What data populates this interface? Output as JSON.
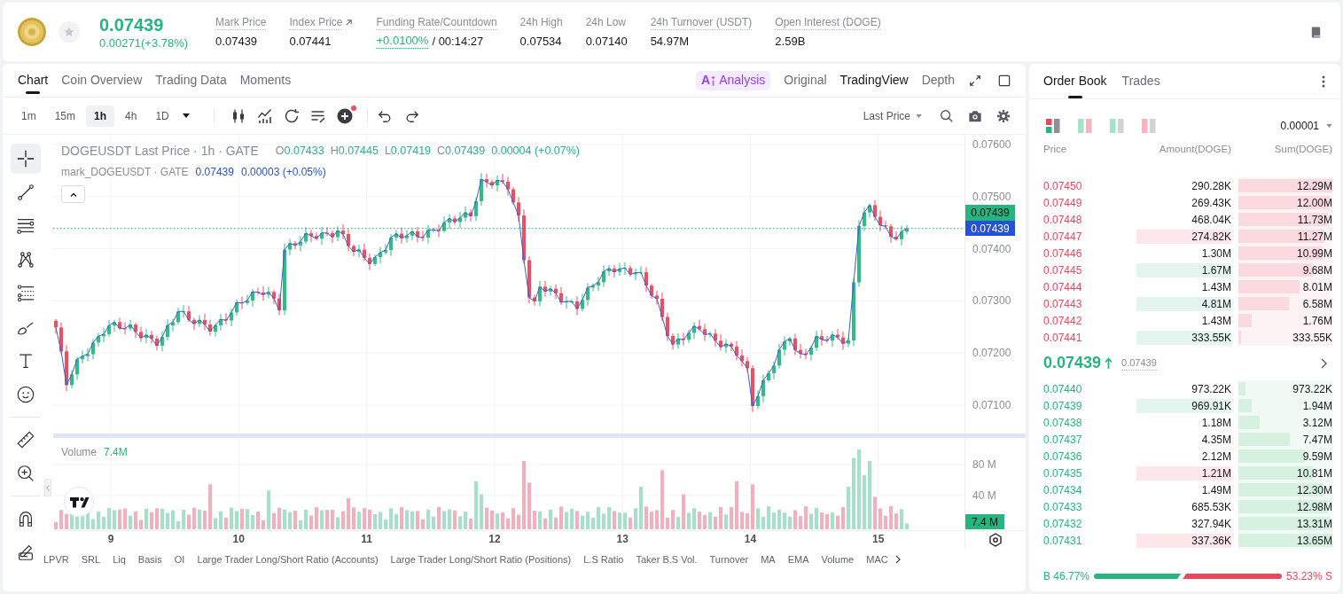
{
  "header": {
    "price": "0.07439",
    "change": "0.00271(+3.78%)",
    "favorite": false,
    "stats": [
      {
        "label": "Mark Price",
        "value": "0.07439",
        "positive": false,
        "dotted": true,
        "external": false
      },
      {
        "label": "Index Price",
        "value": "0.07441",
        "positive": false,
        "dotted": true,
        "external": true
      },
      {
        "label": "Funding Rate/Countdown",
        "value": "+0.0100%",
        "countdown": "/ 00:14:27",
        "positive": true,
        "dotted": true,
        "external": false
      },
      {
        "label": "24h High",
        "value": "0.07534",
        "positive": false,
        "dotted": false,
        "external": false
      },
      {
        "label": "24h Low",
        "value": "0.07140",
        "positive": false,
        "dotted": false,
        "external": false
      },
      {
        "label": "24h Turnover (USDT)",
        "value": "54.97M",
        "positive": false,
        "dotted": true,
        "external": false
      },
      {
        "label": "Open Interest (DOGE)",
        "value": "2.59B",
        "positive": false,
        "dotted": true,
        "external": false
      }
    ]
  },
  "chart": {
    "tabs": [
      {
        "label": "Chart",
        "selected": true
      },
      {
        "label": "Coin Overview",
        "selected": false
      },
      {
        "label": "Trading Data",
        "selected": false
      },
      {
        "label": "Moments",
        "selected": false
      }
    ],
    "ai_button": {
      "badge": "A",
      "label": "Analysis"
    },
    "views": [
      {
        "label": "Original",
        "selected": false
      },
      {
        "label": "TradingView",
        "selected": true
      },
      {
        "label": "Depth",
        "selected": false
      }
    ],
    "intervals": [
      {
        "label": "1m",
        "selected": false
      },
      {
        "label": "15m",
        "selected": false
      },
      {
        "label": "1h",
        "selected": true
      },
      {
        "label": "4h",
        "selected": false
      },
      {
        "label": "1D",
        "selected": false
      }
    ],
    "chart_tools": [
      {
        "kind": "chart-type",
        "notice": false
      },
      {
        "kind": "indicator",
        "notice": false
      },
      {
        "kind": "replay",
        "notice": false
      },
      {
        "kind": "list",
        "notice": false
      },
      {
        "kind": "add",
        "notice": true
      }
    ],
    "history": [
      {
        "kind": "undo"
      },
      {
        "kind": "redo"
      }
    ],
    "price_source": "Last Price",
    "right_tools": [
      {
        "kind": "search"
      },
      {
        "kind": "camera"
      },
      {
        "kind": "settings"
      }
    ],
    "drawing_tools": [
      {
        "tools": [
          {
            "kind": "crosshair",
            "selected": true
          },
          {
            "kind": "trend-line",
            "selected": false
          },
          {
            "kind": "horizontal-lines",
            "selected": false
          },
          {
            "kind": "pattern",
            "selected": false
          },
          {
            "kind": "fibonacci",
            "selected": false
          },
          {
            "kind": "brush",
            "selected": false
          },
          {
            "kind": "text",
            "selected": false
          },
          {
            "kind": "emoji",
            "selected": false
          }
        ]
      },
      {
        "tools": [
          {
            "kind": "ruler",
            "selected": false
          },
          {
            "kind": "zoom",
            "selected": false
          }
        ]
      },
      {
        "tools": [
          {
            "kind": "magnet",
            "selected": false
          },
          {
            "kind": "lock-drawing",
            "selected": false
          }
        ]
      }
    ],
    "legend": {
      "title": "DOGEUSDT Last Price · 1h · GATE",
      "ohlc": [
        {
          "key": "O",
          "value": "0.07433"
        },
        {
          "key": "H",
          "value": "0.07445"
        },
        {
          "key": "L",
          "value": "0.07419"
        },
        {
          "key": "C",
          "value": "0.07439"
        }
      ],
      "change": "0.00004 (+0.07%)"
    },
    "mark_legend": {
      "title": "mark_DOGEUSDT · GATE",
      "value": "0.07439",
      "change": "0.00003 (+0.05%)"
    },
    "price_axis": [
      "0.07600",
      "0.07500",
      "0.07400",
      "0.07300",
      "0.07200",
      "0.07100"
    ],
    "last_price_tag": "0.07439",
    "mark_price_tag": "0.07439",
    "volume": {
      "label": "Volume",
      "value": "7.4M",
      "axis": [
        "80 M",
        "40 M"
      ],
      "tag": "7.4 M"
    },
    "time_axis": [
      "9",
      "10",
      "11",
      "12",
      "13",
      "14",
      "15"
    ],
    "indicators": [
      "LPVR",
      "SRL",
      "Liq",
      "Basis",
      "OI",
      "Large Trader Long/Short Ratio (Accounts)",
      "Large Trader Long/Short Ratio (Positions)",
      "L.S Ratio",
      "Taker B.S Vol.",
      "Turnover",
      "MA",
      "EMA",
      "Volume",
      "MAC"
    ]
  },
  "order_book": {
    "tabs": [
      {
        "label": "Order Book",
        "selected": true
      },
      {
        "label": "Trades",
        "selected": false
      }
    ],
    "layouts": [
      {
        "kind": "both",
        "selected": true
      },
      {
        "kind": "split",
        "selected": false
      },
      {
        "kind": "bids",
        "selected": false
      },
      {
        "kind": "asks",
        "selected": false
      }
    ],
    "precision": "0.00001",
    "columns": [
      "Price",
      "Amount(DOGE)",
      "Sum(DOGE)"
    ],
    "asks": [
      {
        "price": "0.07450",
        "amount": "290.28K",
        "sum": "12.29M",
        "highlight": false,
        "level": 1.0
      },
      {
        "price": "0.07449",
        "amount": "269.43K",
        "sum": "12.00M",
        "highlight": false,
        "level": 0.976
      },
      {
        "price": "0.07448",
        "amount": "468.04K",
        "sum": "11.73M",
        "highlight": false,
        "level": 0.954
      },
      {
        "price": "0.07447",
        "amount": "274.82K",
        "sum": "11.27M",
        "highlight": true,
        "color": "#fde7eb",
        "level": 0.917
      },
      {
        "price": "0.07446",
        "amount": "1.30M",
        "sum": "10.99M",
        "highlight": false,
        "level": 0.894
      },
      {
        "price": "0.07445",
        "amount": "1.67M",
        "sum": "9.68M",
        "highlight": true,
        "color": "#e3f5ee",
        "level": 0.788
      },
      {
        "price": "0.07444",
        "amount": "1.43M",
        "sum": "8.01M",
        "highlight": false,
        "level": 0.652
      },
      {
        "price": "0.07443",
        "amount": "4.81M",
        "sum": "6.58M",
        "highlight": true,
        "color": "#e3f5ee",
        "level": 0.535
      },
      {
        "price": "0.07442",
        "amount": "1.43M",
        "sum": "1.76M",
        "highlight": false,
        "level": 0.143
      },
      {
        "price": "0.07441",
        "amount": "333.55K",
        "sum": "333.55K",
        "highlight": true,
        "color": "#e3f5ee",
        "level": 0.027
      }
    ],
    "last": {
      "price": "0.07439",
      "rising": true,
      "mark": "0.07439"
    },
    "bids": [
      {
        "price": "0.07440",
        "amount": "973.22K",
        "sum": "973.22K",
        "highlight": false,
        "level": 0.071
      },
      {
        "price": "0.07439",
        "amount": "969.91K",
        "sum": "1.94M",
        "highlight": true,
        "color": "#e3f5ee",
        "level": 0.142
      },
      {
        "price": "0.07438",
        "amount": "1.18M",
        "sum": "3.12M",
        "highlight": false,
        "level": 0.229
      },
      {
        "price": "0.07437",
        "amount": "4.35M",
        "sum": "7.47M",
        "highlight": false,
        "level": 0.547
      },
      {
        "price": "0.07436",
        "amount": "2.12M",
        "sum": "9.59M",
        "highlight": false,
        "level": 0.703
      },
      {
        "price": "0.07435",
        "amount": "1.21M",
        "sum": "10.81M",
        "highlight": true,
        "color": "#fde7eb",
        "level": 0.792
      },
      {
        "price": "0.07434",
        "amount": "1.49M",
        "sum": "12.30M",
        "highlight": false,
        "level": 0.901
      },
      {
        "price": "0.07433",
        "amount": "685.53K",
        "sum": "12.98M",
        "highlight": false,
        "level": 0.951
      },
      {
        "price": "0.07432",
        "amount": "327.94K",
        "sum": "13.31M",
        "highlight": false,
        "level": 0.975
      },
      {
        "price": "0.07431",
        "amount": "337.36K",
        "sum": "13.65M",
        "highlight": true,
        "color": "#fde7eb",
        "level": 1.0
      }
    ],
    "ratio": {
      "buy": "B 46.77%",
      "sell": "53.23% S",
      "level": 0.4677
    }
  }
}
